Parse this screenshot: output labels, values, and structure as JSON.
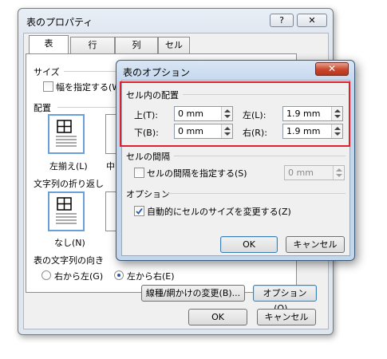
{
  "back_dialog": {
    "title": "表のプロパティ",
    "help_glyph": "?",
    "close_glyph": "✕",
    "tabs": [
      {
        "label": "表",
        "active": true
      },
      {
        "label": "行",
        "active": false
      },
      {
        "label": "列",
        "active": false
      },
      {
        "label": "セル",
        "active": false
      }
    ],
    "size_section": "サイズ",
    "width_checkbox": "幅を指定する(W",
    "layout_section": "配置",
    "align_left_label": "左揃え(L)",
    "align_center_label": "中",
    "wrap_section": "文字列の折り返し",
    "wrap_none_label": "なし(N)",
    "direction_section": "表の文字列の向き",
    "rtl_label": "右から左(G)",
    "ltr_label": "左から右(E)",
    "rtl_selected": false,
    "ltr_selected": true,
    "borders_button": "線種/網かけの変更(B)...",
    "options_button": "オプション(O)...",
    "ok_button": "OK",
    "cancel_button": "キャンセル"
  },
  "front_dialog": {
    "title": "表のオプション",
    "close_glyph": "✕",
    "margins_section": "セル内の配置",
    "top_label": "上(T):",
    "top_value": "0 mm",
    "bottom_label": "下(B):",
    "bottom_value": "0 mm",
    "left_label": "左(L):",
    "left_value": "1.9 mm",
    "right_label": "右(R):",
    "right_value": "1.9 mm",
    "spacing_section": "セルの間隔",
    "spacing_checkbox": "セルの間隔を指定する(S)",
    "spacing_checked": false,
    "spacing_value": "0 mm",
    "options_section": "オプション",
    "autofit_checkbox": "自動的にセルのサイズを変更する(Z)",
    "autofit_checked": true,
    "ok_button": "OK",
    "cancel_button": "キャンセル"
  },
  "colors": {
    "highlight_border": "#e0202c",
    "selection_blue": "#2b56a8"
  }
}
